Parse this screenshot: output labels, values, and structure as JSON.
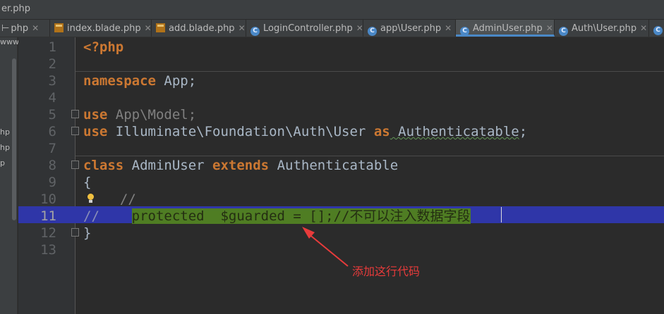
{
  "window": {
    "title": "er.php"
  },
  "tabs": [
    {
      "label": "php",
      "icon": "php-file-icon"
    },
    {
      "label": "index.blade.php",
      "icon": "php-file-icon"
    },
    {
      "label": "add.blade.php",
      "icon": "php-file-icon"
    },
    {
      "label": "LoginController.php",
      "icon": "class-icon"
    },
    {
      "label": "app\\User.php",
      "icon": "class-icon"
    },
    {
      "label": "AdminUser.php",
      "icon": "class-icon",
      "active": true
    },
    {
      "label": "Auth\\User.php",
      "icon": "class-icon"
    }
  ],
  "left_panel": {
    "items": [
      "www",
      "hp",
      "hp",
      "p"
    ]
  },
  "editor": {
    "line_numbers": [
      "1",
      "2",
      "3",
      "4",
      "5",
      "6",
      "7",
      "8",
      "9",
      "10",
      "11",
      "12",
      "13"
    ],
    "lines": {
      "l1": "<?php",
      "l3_kw": "namespace",
      "l3_rest": " App;",
      "l5_kw": "use",
      "l5_rest": " App\\Model;",
      "l6_kw": "use",
      "l6_ns": " Illuminate\\Foundation\\Auth\\User ",
      "l6_as": "as",
      "l6_alias": " Authenticatable",
      "l6_end": ";",
      "l8_kw": "class",
      "l8_name": " AdminUser ",
      "l8_ext": "extends",
      "l8_parent": " Authenticatable",
      "l9": "{",
      "l10": "  //",
      "l11_prefix": "//    ",
      "l11_selected": "protected  $guarded = [];//不可以注入数据字段",
      "l12": "}"
    },
    "highlighted_line": 11
  },
  "annotation": {
    "text": "添加这行代码",
    "color": "#e83b3b"
  },
  "colors": {
    "keyword": "#cc7832",
    "text": "#a9b7c6",
    "selection": "#4f7d23",
    "line_highlight": "#2f36a8"
  }
}
